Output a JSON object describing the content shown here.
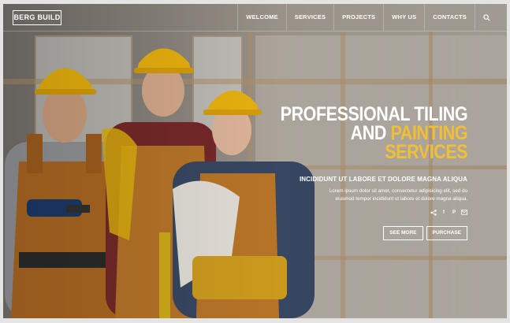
{
  "brand": {
    "logo": "BERG BUILD"
  },
  "nav": {
    "items": [
      "WELCOME",
      "SERVICES",
      "PROJECTS",
      "WHY US",
      "CONTACTS"
    ],
    "search_icon": "search-icon"
  },
  "hero": {
    "title_line1": "PROFESSIONAL TILING",
    "title_line2_white": "AND ",
    "title_line2_accent": "PAINTING",
    "title_line3_accent": "SERVICES",
    "subtitle": "INCIDIDUNT UT LABORE ET DOLORE MAGNA ALIQUA",
    "description_line1": "Lorem ipsum dolor sit amet, consectetur adipisicing elit, sed do",
    "description_line2": "eiusmod tempor incididunt ut labore et dolore magna aliqua.",
    "social": [
      "share-icon",
      "facebook-icon",
      "pinterest-icon",
      "email-icon"
    ],
    "buttons": {
      "see_more": "SEE MORE",
      "purchase": "PURCHASE"
    }
  },
  "colors": {
    "accent": "#f3be33",
    "text": "#ffffff",
    "frame": "#e4e4e4"
  }
}
